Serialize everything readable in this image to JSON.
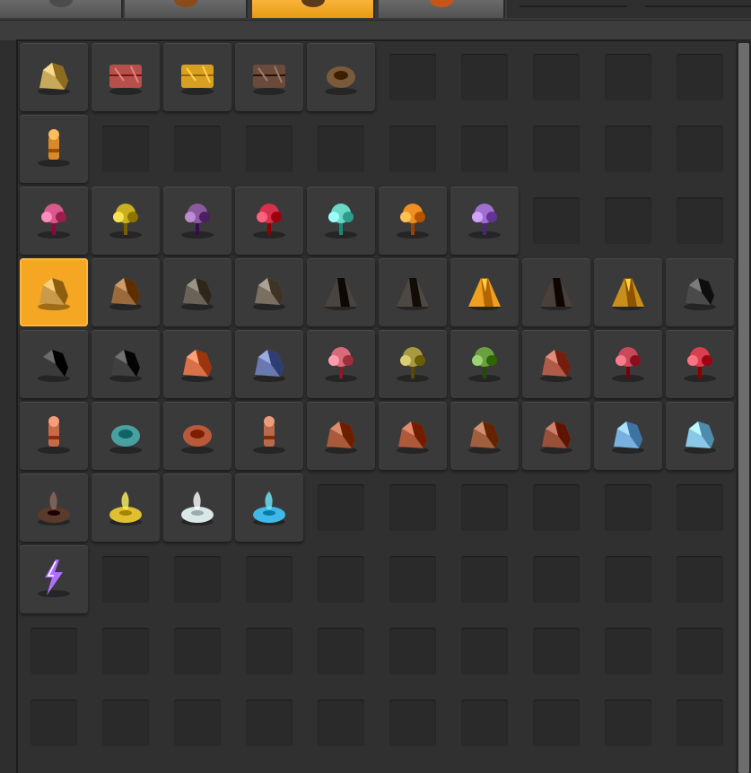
{
  "tabs": [
    {
      "name": "tab-1",
      "icon": "scenery-icon",
      "selected": false,
      "color": "#4c4c4c"
    },
    {
      "name": "tab-2",
      "icon": "tree-icon",
      "selected": false,
      "color": "#8a4a1a"
    },
    {
      "name": "tab-3",
      "icon": "tree-stump-icon",
      "selected": true,
      "color": "#5a3a1a"
    },
    {
      "name": "tab-4",
      "icon": "crate-icon",
      "selected": false,
      "color": "#c8541a"
    }
  ],
  "grid": {
    "columns": 10,
    "rows": [
      [
        {
          "icon": "cliff-icon",
          "color": "#c8a85a"
        },
        {
          "icon": "treasure-chest-icon",
          "color": "#b5504a"
        },
        {
          "icon": "root-carpet-icon",
          "color": "#d8a020"
        },
        {
          "icon": "rock-slab-icon",
          "color": "#6a4a3a"
        },
        {
          "icon": "ring-nest-icon",
          "color": "#7a5a3a"
        },
        null,
        null,
        null,
        null,
        null
      ],
      [
        {
          "icon": "character-icon",
          "color": "#d88a2a"
        },
        null,
        null,
        null,
        null,
        null,
        null,
        null,
        null,
        null
      ],
      [
        {
          "icon": "coral-tree-icon",
          "color": "#d85a8a"
        },
        {
          "icon": "yellow-bush-icon",
          "color": "#c8b020"
        },
        {
          "icon": "mushroom-tree-icon",
          "color": "#8a5aa0"
        },
        {
          "icon": "red-flower-icon",
          "color": "#d8304a"
        },
        {
          "icon": "cyan-plant-icon",
          "color": "#6ad8c8"
        },
        {
          "icon": "orange-fungus-icon",
          "color": "#f09020"
        },
        {
          "icon": "purple-vine-icon",
          "color": "#a070d0"
        },
        null,
        null,
        null
      ],
      [
        {
          "icon": "gold-ore-rock-icon",
          "color": "#c89a4a",
          "selected": true
        },
        {
          "icon": "brown-rock-icon",
          "color": "#9a6a3a"
        },
        {
          "icon": "grey-rock-icon",
          "color": "#6a6256"
        },
        {
          "icon": "grey-rock-cluster-icon",
          "color": "#7a7062"
        },
        {
          "icon": "volcano-dark-icon",
          "color": "#4a4440"
        },
        {
          "icon": "crater-icon",
          "color": "#4e4842"
        },
        {
          "icon": "volcano-lava-icon",
          "color": "#f0a020"
        },
        {
          "icon": "volcano-icon",
          "color": "#4a403a"
        },
        {
          "icon": "volcano-ember-icon",
          "color": "#c8901a"
        },
        {
          "icon": "dark-rock-icon",
          "color": "#4a4a4a"
        }
      ],
      [
        {
          "icon": "coal-rock-icon",
          "color": "#3a3a3a"
        },
        {
          "icon": "coal-cluster-icon",
          "color": "#404040"
        },
        {
          "icon": "moss-rock-icon",
          "color": "#d8704a"
        },
        {
          "icon": "blue-moss-rock-icon",
          "color": "#6a7ab0"
        },
        {
          "icon": "pink-spider-plant-icon",
          "color": "#d86a7a"
        },
        {
          "icon": "olive-spider-plant-icon",
          "color": "#a89a40"
        },
        {
          "icon": "green-spider-plant-icon",
          "color": "#6aa040"
        },
        {
          "icon": "red-boulder-icon",
          "color": "#b05a4a"
        },
        {
          "icon": "red-worm-icon",
          "color": "#c84a5a"
        },
        {
          "icon": "red-coral-icon",
          "color": "#d84050"
        }
      ],
      [
        {
          "icon": "turret-tower-icon",
          "color": "#c86a4a"
        },
        {
          "icon": "spawner-egg-icon",
          "color": "#4aa0a0"
        },
        {
          "icon": "nest-mound-icon",
          "color": "#b85a3a"
        },
        {
          "icon": "rusted-tower-icon",
          "color": "#b86a4a"
        },
        {
          "icon": "ruined-arch-icon",
          "color": "#a85a3a"
        },
        {
          "icon": "ruined-machine-icon",
          "color": "#b0583a"
        },
        {
          "icon": "wrecked-drum-icon",
          "color": "#a06040"
        },
        {
          "icon": "wreck-debris-icon",
          "color": "#9a5038"
        },
        {
          "icon": "ice-rock-icon",
          "color": "#7ab0e0"
        },
        {
          "icon": "ice-crystal-icon",
          "color": "#8ac8e8"
        }
      ],
      [
        {
          "icon": "dirt-pile-icon",
          "color": "#5a3a2a"
        },
        {
          "icon": "sulfur-vent-icon",
          "color": "#e0c030"
        },
        {
          "icon": "steam-vent-icon",
          "color": "#d8e8e8"
        },
        {
          "icon": "blue-geyser-icon",
          "color": "#40b8e8"
        },
        null,
        null,
        null,
        null,
        null,
        null
      ],
      [
        {
          "icon": "lightning-icon",
          "color": "#b070ff"
        },
        null,
        null,
        null,
        null,
        null,
        null,
        null,
        null,
        null
      ],
      [
        null,
        null,
        null,
        null,
        null,
        null,
        null,
        null,
        null,
        null
      ],
      [
        null,
        null,
        null,
        null,
        null,
        null,
        null,
        null,
        null,
        null
      ]
    ]
  }
}
